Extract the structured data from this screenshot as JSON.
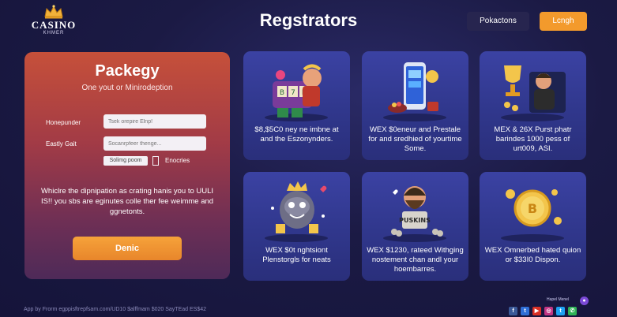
{
  "header": {
    "logo_line1": "CASINO",
    "logo_line2": "KHMER",
    "title": "Regstrators",
    "btn_dark_label": "Pokactons",
    "btn_orange_label": "Lcngh"
  },
  "register": {
    "title": "Packegy",
    "subtitle": "One yout or Minirodeption",
    "field1_label": "Honepunder",
    "field1_placeholder": "Tsek orepire Elnp!",
    "field2_label": "Eastly Gait",
    "field2_placeholder": "Socanrpfeer thenge...",
    "small_button": "Solimg poom",
    "checkbox_label": "Enocries",
    "description": "Whiclre the dipnipation as crating hanis you to UULI IS!! you sbs are eginutes colle ther fee weimme and ggnetonts.",
    "submit_label": "Denic"
  },
  "cards": [
    {
      "icon": "slot-machine-mascot-icon",
      "text": "$8,$5C0 ney ne imbne at and the Eszonynders."
    },
    {
      "icon": "mobile-phone-slots-icon",
      "text": "WEX $0eneur and Prestale for and sredhied of yourtime Some."
    },
    {
      "icon": "trophy-winner-icon",
      "text": "MEX & 26X Purst phatr barindes 1000 pess of urt009, ASI."
    },
    {
      "icon": "crowned-mascot-icon",
      "text": "WEX $0t nghtsiont Plenstorgls for neats"
    },
    {
      "icon": "bearded-man-sign-icon",
      "text": "WEX $1230, rateed Withging nostement chan andl your hoembarres."
    },
    {
      "icon": "gold-coin-icon",
      "text": "WEX Omnerbed hated quion or $33I0 Dispon."
    }
  ],
  "footer": {
    "text": "App by Frorm egppisftrepfsam.com/UD10 $alffmam $020 SayTEad ES$42",
    "right_label": "Hapel Menel",
    "social_icons": [
      "facebook-icon",
      "t-icon",
      "youtube-icon",
      "instagram-icon",
      "twitter-icon",
      "whatsapp-icon"
    ]
  },
  "colors": {
    "accent_orange": "#f39a2c",
    "panel_red": "#c6503a",
    "card_blue": "#3b42a3",
    "background": "#1b1a44"
  }
}
